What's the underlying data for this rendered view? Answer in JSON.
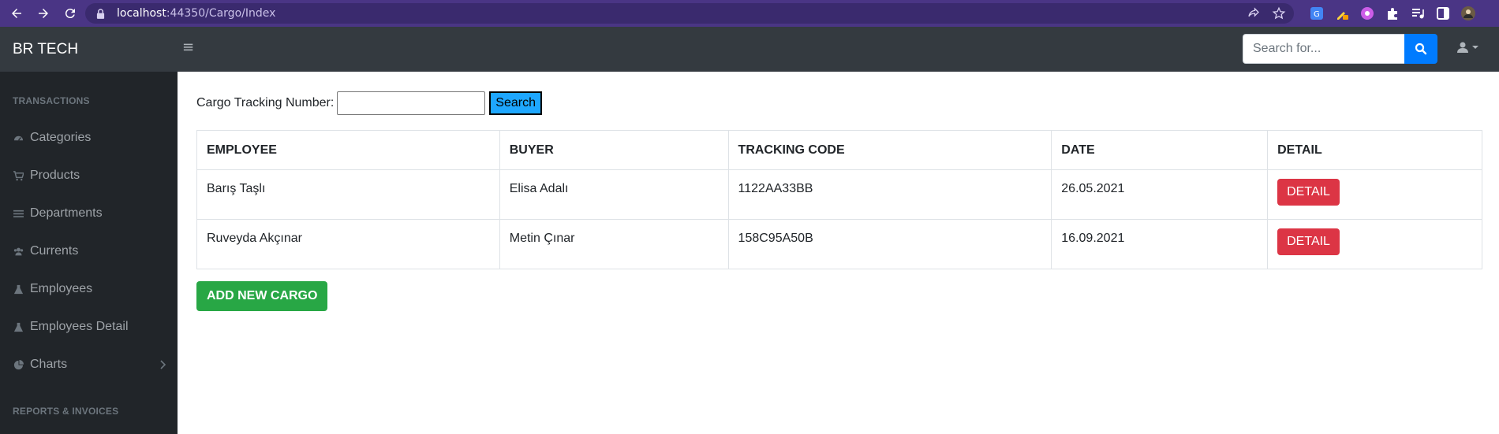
{
  "browser": {
    "url_host": "localhost",
    "url_rest": ":44350/Cargo/Index"
  },
  "topnav": {
    "brand": "BR TECH",
    "search_placeholder": "Search for..."
  },
  "sidebar": {
    "heading_transactions": "TRANSACTIONS",
    "heading_reports": "REPORTS & INVOICES",
    "items": [
      {
        "label": "Categories",
        "icon": "tachometer-icon"
      },
      {
        "label": "Products",
        "icon": "cart-icon"
      },
      {
        "label": "Departments",
        "icon": "list-icon"
      },
      {
        "label": "Currents",
        "icon": "users-icon"
      },
      {
        "label": "Employees",
        "icon": "flask-icon"
      },
      {
        "label": "Employees Detail",
        "icon": "flask-icon"
      },
      {
        "label": "Charts",
        "icon": "pie-chart-icon"
      }
    ]
  },
  "search": {
    "label": "Cargo Tracking Number:",
    "value": "",
    "button": "Search"
  },
  "table": {
    "headers": [
      "EMPLOYEE",
      "BUYER",
      "TRACKING CODE",
      "DATE",
      "DETAIL"
    ],
    "rows": [
      {
        "employee": "Barış Taşlı",
        "buyer": "Elisa Adalı",
        "tracking_code": "1122AA33BB",
        "date": "26.05.2021",
        "detail": "DETAIL"
      },
      {
        "employee": "Ruveyda Akçınar",
        "buyer": "Metin Çınar",
        "tracking_code": "158C95A50B",
        "date": "16.09.2021",
        "detail": "DETAIL"
      }
    ]
  },
  "add_button": "ADD NEW CARGO",
  "colors": {
    "browser_bar": "#4a3585",
    "topnav": "#343a40",
    "sidebar": "#212529",
    "primary": "#007bff",
    "danger": "#dc3545",
    "success": "#28a745"
  }
}
